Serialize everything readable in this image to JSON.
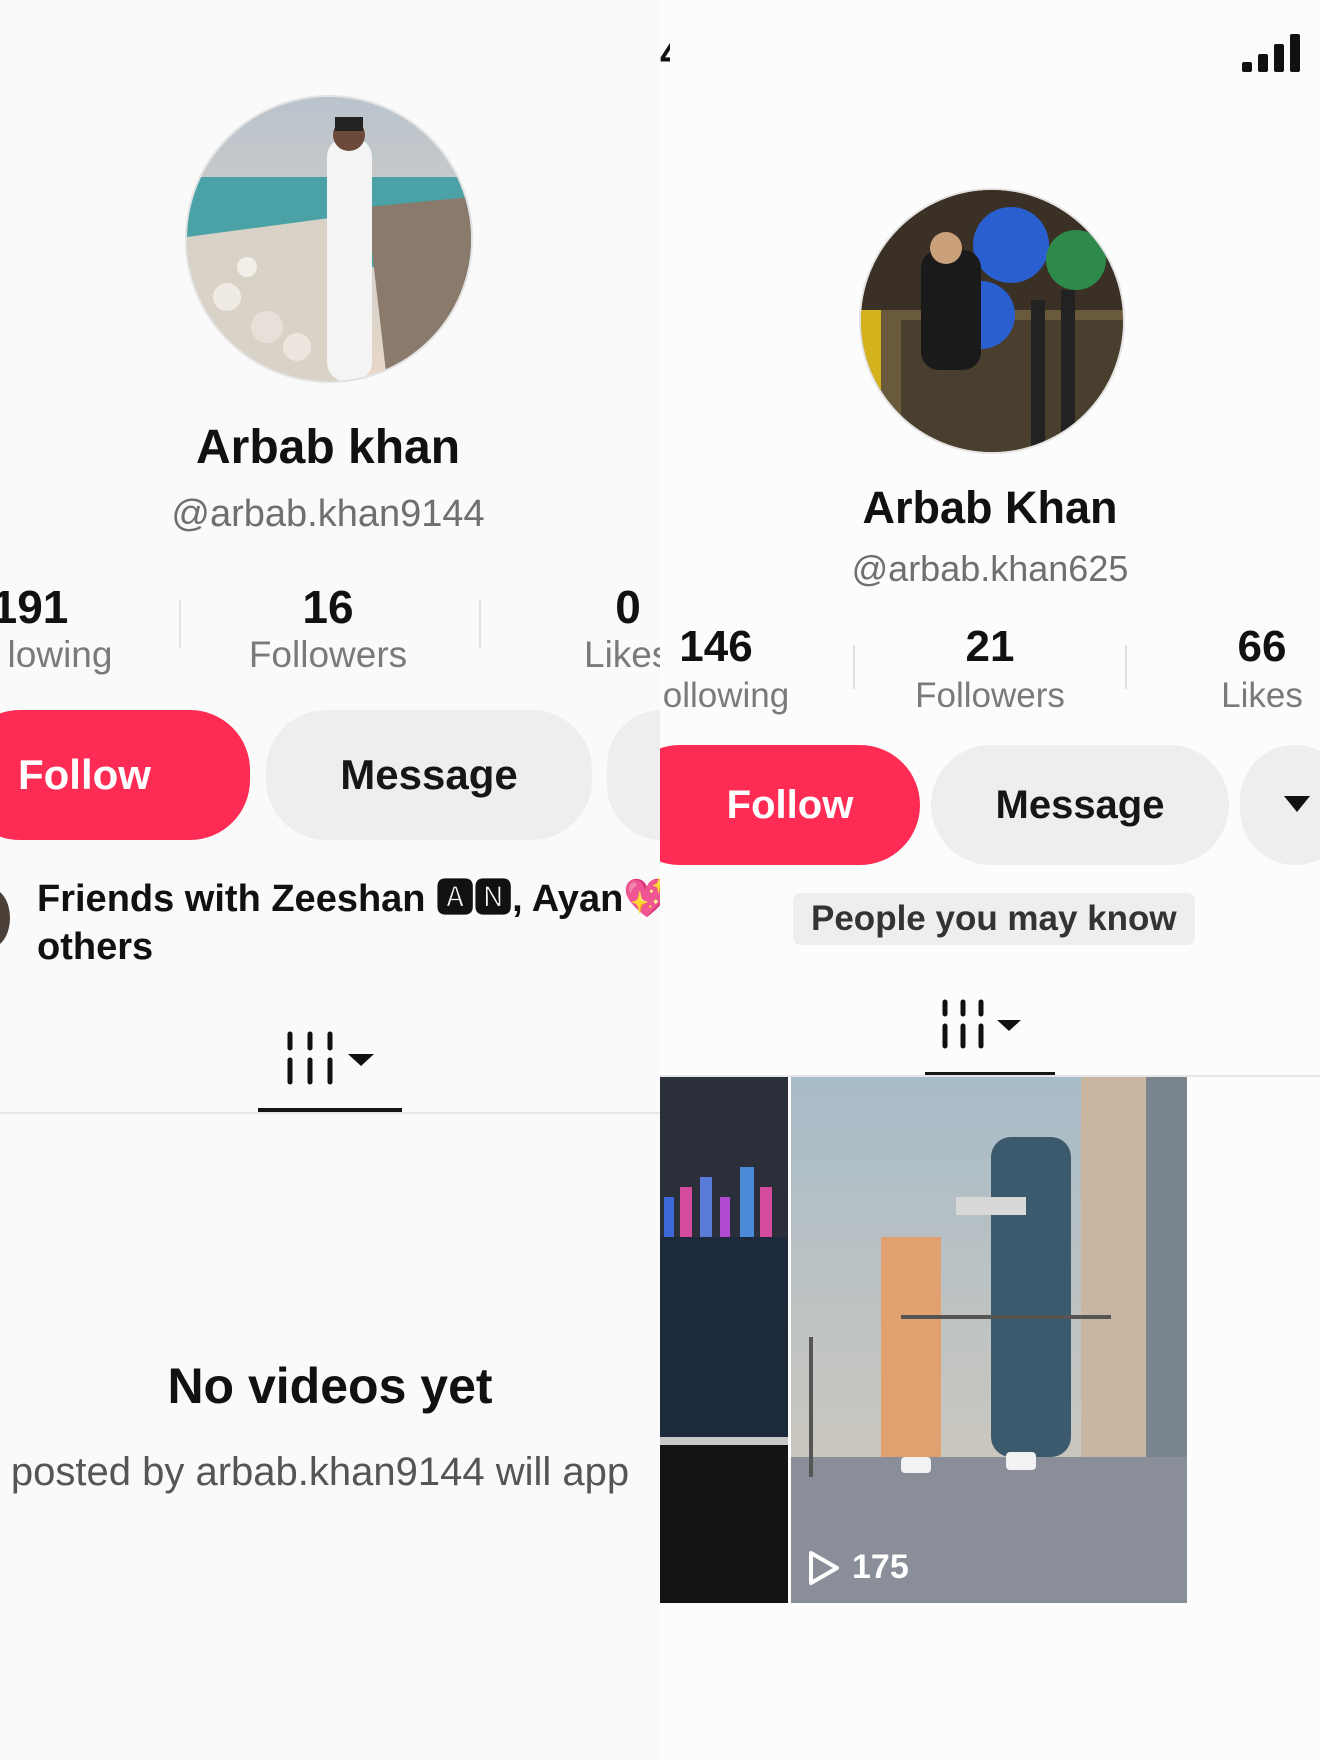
{
  "left": {
    "display_name": "Arbab khan",
    "username": "@arbab.khan9144",
    "stats": [
      {
        "value": "191",
        "label": "lowing"
      },
      {
        "value": "16",
        "label": "Followers"
      },
      {
        "value": "0",
        "label": "Likes"
      }
    ],
    "follow_label": "Follow",
    "message_label": "Message",
    "friends_line1": "Friends with Zeeshan 🅰🅽, Ayan💖",
    "friends_line2": "others",
    "empty_title": "No videos yet",
    "empty_subtitle": "posted by arbab.khan9144 will app"
  },
  "right": {
    "display_name": "Arbab Khan",
    "username": "@arbab.khan625",
    "stats": [
      {
        "value": "146",
        "label": "ollowing"
      },
      {
        "value": "21",
        "label": "Followers"
      },
      {
        "value": "66",
        "label": "Likes"
      }
    ],
    "follow_label": "Follow",
    "message_label": "Message",
    "suggestion_badge": "People you may know",
    "video_views": "175"
  },
  "status": {
    "partial_time": "4"
  },
  "colors": {
    "accent": "#fe2c55",
    "button_grey": "#eeeeee",
    "muted_text": "#7a7a7a"
  },
  "icons": [
    "signal-bars-icon",
    "videos-grid-icon",
    "caret-down-icon",
    "play-icon"
  ]
}
